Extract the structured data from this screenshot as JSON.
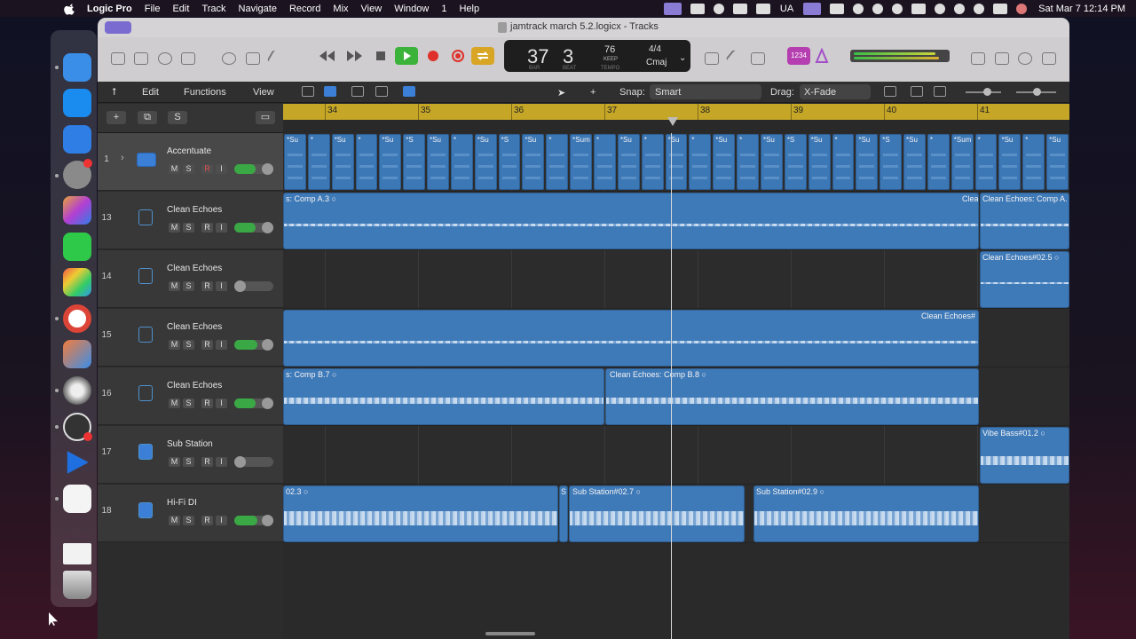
{
  "menubar": {
    "app": "Logic Pro",
    "items": [
      "File",
      "Edit",
      "Track",
      "Navigate",
      "Record",
      "Mix",
      "View",
      "Window",
      "1",
      "Help"
    ],
    "status_ua": "UA",
    "datetime": "Sat Mar 7  12:14 PM"
  },
  "window": {
    "title": "jamtrack march 5.2.logicx - Tracks"
  },
  "lcd": {
    "bar": "37",
    "beat": "3",
    "bar_label": "BAR",
    "beat_label": "BEAT",
    "tempo": "76",
    "keep_label": "KEEP",
    "tempo_label": "TEMPO",
    "signature": "4/4",
    "key": "Cmaj"
  },
  "counter_button": "1234",
  "toolbar": {
    "edit": "Edit",
    "functions": "Functions",
    "view": "View",
    "snap_label": "Snap:",
    "snap_value": "Smart",
    "drag_label": "Drag:",
    "drag_value": "X-Fade"
  },
  "track_header": {
    "s_button": "S"
  },
  "ruler": {
    "bars": [
      "34",
      "35",
      "36",
      "37",
      "38",
      "39",
      "40",
      "41"
    ]
  },
  "track_buttons": {
    "m": "M",
    "s": "S",
    "r": "R",
    "i": "I"
  },
  "tracks": [
    {
      "num": "1",
      "name": "Accentuate"
    },
    {
      "num": "13",
      "name": "Clean Echoes"
    },
    {
      "num": "14",
      "name": "Clean Echoes"
    },
    {
      "num": "15",
      "name": "Clean Echoes"
    },
    {
      "num": "16",
      "name": "Clean Echoes"
    },
    {
      "num": "17",
      "name": "Sub Station"
    },
    {
      "num": "18",
      "name": "Hi-Fi DI"
    }
  ],
  "midi_labels": [
    "*Su",
    "*",
    "*Su",
    "*",
    "*Su",
    "*S",
    "*Su",
    "*",
    "*Su",
    "*S",
    "*Su",
    "*",
    "*Sum",
    "*",
    "*Su",
    "*",
    "*Su",
    "*",
    "*Su",
    "*",
    "*Su",
    "*S",
    "*Su",
    "*",
    "*Su",
    "*S",
    "*Su",
    "*",
    "*Sum",
    "*",
    "*Su",
    "*",
    "*Su"
  ],
  "regions": {
    "l13a": "s: Comp A.3  ○",
    "l13b": "Clea",
    "l13c": "Clean Echoes: Comp A.",
    "l14": "Clean Echoes#02.5  ○",
    "l15": "Clean Echoes#",
    "l16a": "s: Comp B.7  ○",
    "l16b": "Clean Echoes: Comp B.8  ○",
    "l17": "Vibe Bass#01.2  ○",
    "l18a": "02.3  ○",
    "l18b": "S",
    "l18c": "Sub Station#02.7  ○",
    "l18d": "Sub Station#02.9  ○"
  },
  "colors": {
    "region": "#3e79b8",
    "ruler": "#c5a627",
    "play": "#3bb33b",
    "record": "#e0302a",
    "cycle": "#d8a524",
    "fader": "#3aa845"
  },
  "faders": [
    0.55,
    0.55,
    0.0,
    0.6,
    0.55,
    0.0,
    0.6
  ]
}
